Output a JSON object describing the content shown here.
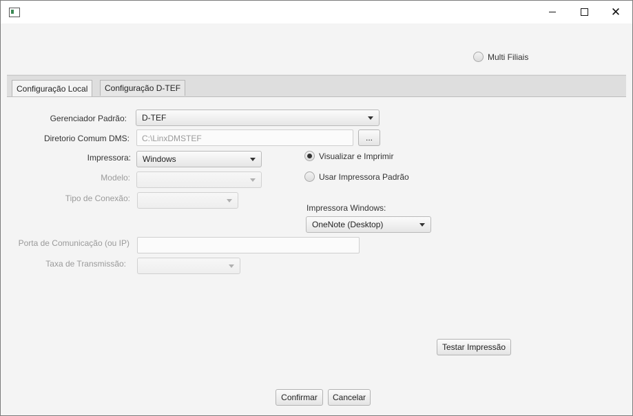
{
  "window": {
    "app_icon": "java-app-icon",
    "controls": {
      "minimize": "minimize-icon",
      "maximize": "maximize-icon",
      "close": "close-icon"
    }
  },
  "top": {
    "multi_filiais": {
      "label": "Multi Filiais",
      "checked": false
    }
  },
  "tabs": [
    {
      "label": "Configuração Local",
      "active": true
    },
    {
      "label": "Configuração D-TEF",
      "active": false
    }
  ],
  "form": {
    "gerenciador": {
      "label": "Gerenciador Padrão:",
      "value": "D-TEF"
    },
    "diretorio": {
      "label": "Diretorio Comum DMS:",
      "value": "C:\\LinxDMSTEF",
      "browse_label": "..."
    },
    "impressora": {
      "label": "Impressora:",
      "value": "Windows"
    },
    "modelo": {
      "label": "Modelo:",
      "value": ""
    },
    "tipo_conexao": {
      "label": "Tipo de Conexão:",
      "value": ""
    },
    "porta": {
      "label": "Porta de Comunicação (ou IP)",
      "value": ""
    },
    "taxa": {
      "label": "Taxa de Transmissão:",
      "value": ""
    },
    "print_mode": [
      {
        "label": "Visualizar e Imprimir",
        "checked": true
      },
      {
        "label": "Usar Impressora Padrão",
        "checked": false
      }
    ],
    "impressora_windows": {
      "label": "Impressora Windows:",
      "value": "OneNote (Desktop)"
    },
    "testar_label": "Testar Impressão"
  },
  "footer": {
    "confirm_label": "Confirmar",
    "cancel_label": "Cancelar"
  }
}
